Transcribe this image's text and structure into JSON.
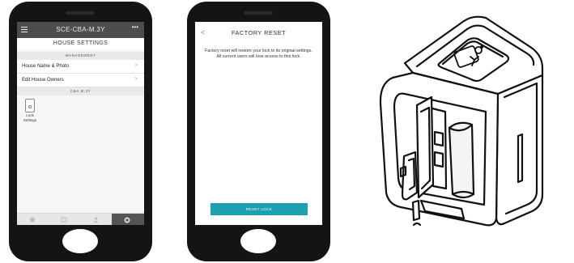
{
  "left_phone": {
    "app_title": "SCE-CBA-M.3Y",
    "menu_icon": "hamburger-menu-icon",
    "more_icon": "ellipsis-icon",
    "more_glyph": "•••",
    "screen_title": "HOUSE SETTINGS",
    "management_header": "MANAGEMENT",
    "rows": [
      {
        "label": "House Name & Photo",
        "chevron": ">"
      },
      {
        "label": "Edit House Owners",
        "chevron": ">"
      }
    ],
    "lock_header": "CBA.M.3Y",
    "lock_tile": {
      "label_line1": "Lock",
      "label_line2": "Settings",
      "icon": "lock-device-icon"
    },
    "tabs": [
      {
        "icon": "home-icon",
        "active": false
      },
      {
        "icon": "history-icon",
        "active": false
      },
      {
        "icon": "users-icon",
        "active": false
      },
      {
        "icon": "gear-icon",
        "active": true
      }
    ]
  },
  "right_phone": {
    "back_glyph": "<",
    "screen_title": "FACTORY RESET",
    "message": "Factory reset will restore your lock to its original settings. All current users will lose access to this lock.",
    "button_label": "RESET LOCK",
    "button_color": "#1fa0b0"
  },
  "illustration": {
    "subject": "smart-lock-device-open-cover",
    "icon": "smart-lock-icon"
  },
  "colors": {
    "phone_body": "#141414",
    "topbar": "#4d4d4d",
    "active_tab": "#555555",
    "accent": "#1fa0b0"
  }
}
